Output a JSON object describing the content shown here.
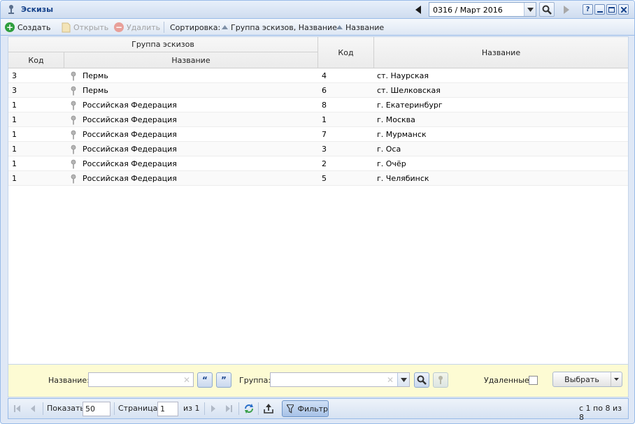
{
  "window": {
    "title": "Эскизы"
  },
  "period": {
    "value": "0316 / Март 2016"
  },
  "toolbar": {
    "create": "Создать",
    "open": "Открыть",
    "delete": "Удалить",
    "sort_label": "Сортировка:",
    "sort1": "Группа эскизов, Название",
    "sort2": "Название"
  },
  "grid": {
    "group_header": "Группа эскизов",
    "group_code": "Код",
    "group_name": "Название",
    "code": "Код",
    "name": "Название",
    "rows": [
      {
        "gcode": "3",
        "gname": "Пермь",
        "code": "4",
        "name": "ст. Наурская"
      },
      {
        "gcode": "3",
        "gname": "Пермь",
        "code": "6",
        "name": "ст. Шелковская"
      },
      {
        "gcode": "1",
        "gname": "Российская Федерация",
        "code": "8",
        "name": "г. Екатеринбург"
      },
      {
        "gcode": "1",
        "gname": "Российская Федерация",
        "code": "1",
        "name": "г. Москва"
      },
      {
        "gcode": "1",
        "gname": "Российская Федерация",
        "code": "7",
        "name": "г. Мурманск"
      },
      {
        "gcode": "1",
        "gname": "Российская Федерация",
        "code": "3",
        "name": "г. Оса"
      },
      {
        "gcode": "1",
        "gname": "Российская Федерация",
        "code": "2",
        "name": "г. Очёр"
      },
      {
        "gcode": "1",
        "gname": "Российская Федерация",
        "code": "5",
        "name": "г. Челябинск"
      }
    ]
  },
  "filter": {
    "name_label": "Название:",
    "name_value": "",
    "group_label": "Группа:",
    "group_value": "",
    "deleted_label": "Удаленные:",
    "select_button": "Выбрать"
  },
  "paging": {
    "show_label": "Показать",
    "page_size": "50",
    "page_label": "Страница",
    "page_value": "1",
    "of_label": "из 1",
    "filter_button": "Фильтр",
    "summary": "с 1 по 8 из 8"
  }
}
